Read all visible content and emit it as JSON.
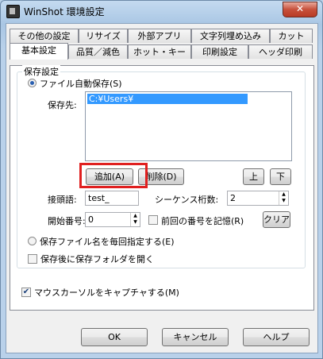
{
  "window": {
    "title": "WinShot 環境設定",
    "close_glyph": "✕"
  },
  "tabs_row1": [
    "その他の設定",
    "リサイズ",
    "外部アプリ",
    "文字列埋め込み",
    "カット"
  ],
  "tabs_row2": [
    "基本設定",
    "品質／減色",
    "ホット・キー",
    "印刷設定",
    "ヘッダ印刷"
  ],
  "group": {
    "title": "保存設定"
  },
  "auto_save": {
    "label": "ファイル自動保存(S)",
    "selected": true
  },
  "save_to": {
    "label": "保存先:",
    "items": [
      "C:¥Users¥"
    ]
  },
  "buttons": {
    "add": "追加(A)",
    "delete": "削除(D)",
    "up": "上",
    "down": "下",
    "clear": "クリア"
  },
  "prefix": {
    "label": "接頭語:",
    "value": "test_"
  },
  "seq_digits": {
    "label": "シーケンス桁数:",
    "value": "2"
  },
  "start_num": {
    "label": "開始番号:",
    "value": "0"
  },
  "remember": {
    "label": "前回の番号を記憶(R)",
    "checked": false
  },
  "specify_each": {
    "label": "保存ファイル名を毎回指定する(E)",
    "selected": false
  },
  "open_folder": {
    "label": "保存後に保存フォルダを開く",
    "checked": false
  },
  "capture_cursor": {
    "label": "マウスカーソルをキャプチャする(M)",
    "checked": true
  },
  "footer": {
    "ok": "OK",
    "cancel": "キャンセル",
    "help": "ヘルプ"
  },
  "colors": {
    "highlight": "#e02020",
    "selection": "#3399ff"
  }
}
